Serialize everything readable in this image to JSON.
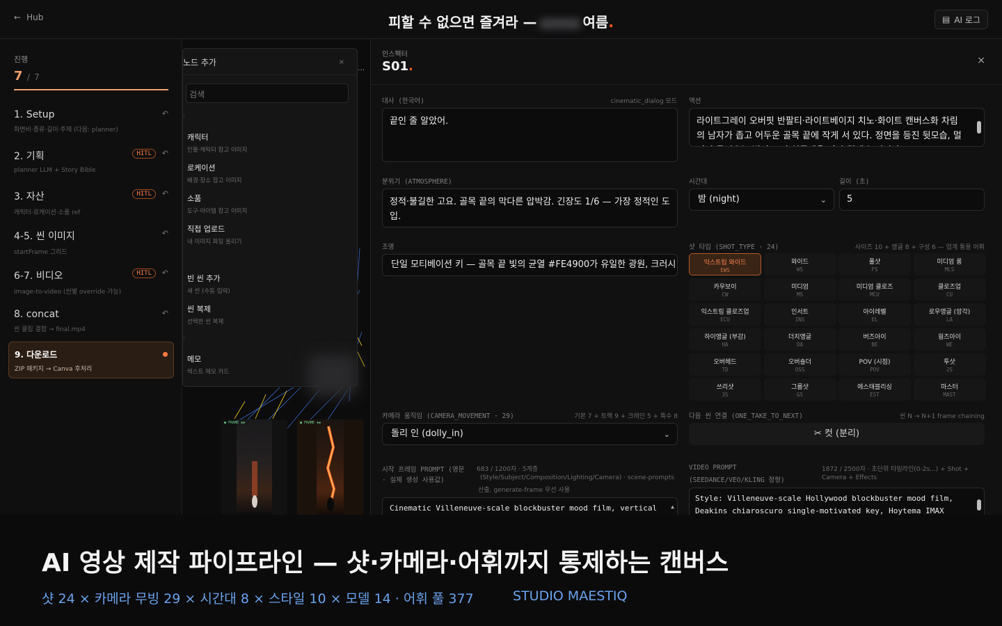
{
  "topbar": {
    "back_label": "Hub",
    "title_prefix": "피할 수 없으면 즐겨라 —",
    "title_suffix": "여름",
    "title_dot": ".",
    "ai_log_label": "AI 로그"
  },
  "progress": {
    "label": "진행",
    "current": "7",
    "separator": "/",
    "total": "7",
    "fraction": 1.0,
    "steps": [
      {
        "name": "1. Setup",
        "sub": "화면비·종류·길이·주제 (다음: planner)",
        "hitl": ""
      },
      {
        "name": "2. 기획",
        "sub": "planner LLM + Story Bible",
        "hitl": "HITL"
      },
      {
        "name": "3. 자산",
        "sub": "캐릭터·로케이션·소품 ref",
        "hitl": "HITL"
      },
      {
        "name": "4-5. 씬 이미지",
        "sub": "startFrame 그리드",
        "hitl": ""
      },
      {
        "name": "6-7. 비디오",
        "sub": "image-to-video (씬별 override 가능)",
        "hitl": "HITL"
      },
      {
        "name": "8. concat",
        "sub": "씬 클립 결합 → final.mp4",
        "hitl": ""
      },
      {
        "name": "9. 다운로드",
        "sub": "ZIP 패키지 → Canva 후처리",
        "hitl": ""
      }
    ],
    "undo_icon": "↶"
  },
  "node_menu": {
    "title": "노드 추가",
    "close": "×",
    "search_placeholder": "검색",
    "items": [
      {
        "title": "캐릭터",
        "desc": "인물·캐릭터 참고 이미지"
      },
      {
        "title": "로케이션",
        "desc": "배경·장소 참고 이미지"
      },
      {
        "title": "소품",
        "desc": "도구·아이템 참고 이미지"
      },
      {
        "title": "직접 업로드",
        "desc": "내 이미지 파일 올리기"
      },
      {
        "title": "빈 씬 추가",
        "desc": "새 씬 (수동 입력)"
      },
      {
        "title": "씬 복제",
        "desc": "선택한 씬 복제"
      },
      {
        "title": "메모",
        "desc": "텍스트 메모 카드"
      }
    ]
  },
  "inspector": {
    "label": "인스펙터",
    "scene_id": "S01",
    "dot": ".",
    "close": "×",
    "dialog": {
      "label": "대사 (한국어)",
      "hint": "cinematic_dialog 모드",
      "value": "끝인 줄 알았어."
    },
    "action": {
      "label": "액션",
      "value": "라이트그레이 오버핏 반팔티·라이트베이지 치노·화이트 캔버스화 차림의 남자가 좁고 어두운 골목 끝에 작게 서 있다. 정면을 등진 뒷모습, 멀리서 들어오는 빛이 그의 실루엣을 따라 길게 늘어진다."
    },
    "atmosphere": {
      "label": "분위기 (ATMOSPHERE)",
      "value": "정적·불길한 고요. 골목 끝의 막다른 압박감. 긴장도 1/6 — 가장 정적인 도입."
    },
    "time_of_day": {
      "label": "시간대",
      "value": "밤 (night)"
    },
    "length": {
      "label": "길이 (초)",
      "value": "5"
    },
    "lighting": {
      "label": "조명",
      "value": "단일 모티베이션 키 — 골목 끝 빛의 균열 #FE4900가 유일한 광원, 크러시 블랙"
    },
    "shot_type": {
      "label": "샷 타입 (SHOT_TYPE · 24)",
      "hint": "사이즈 10 + 앵글 8 + 구성 6 — 업계 통용 어휘",
      "options": [
        {
          "k": "익스트림 와이드",
          "c": "EWS",
          "selected": true
        },
        {
          "k": "와이드",
          "c": "WS"
        },
        {
          "k": "풀샷",
          "c": "FS"
        },
        {
          "k": "미디엄 롱",
          "c": "MLS"
        },
        {
          "k": "카우보이",
          "c": "CW"
        },
        {
          "k": "미디엄",
          "c": "MS"
        },
        {
          "k": "미디엄 클로즈",
          "c": "MCU"
        },
        {
          "k": "클로즈업",
          "c": "CU"
        },
        {
          "k": "익스트림 클로즈업",
          "c": "ECU"
        },
        {
          "k": "인서트",
          "c": "INS"
        },
        {
          "k": "아이레벨",
          "c": "EL"
        },
        {
          "k": "로우앵글 (앙각)",
          "c": "LA"
        },
        {
          "k": "하이앵글 (부감)",
          "c": "HA"
        },
        {
          "k": "더치앵글",
          "c": "DA"
        },
        {
          "k": "버즈아이",
          "c": "BE"
        },
        {
          "k": "웜즈아이",
          "c": "WE"
        },
        {
          "k": "오버헤드",
          "c": "TD"
        },
        {
          "k": "오버숄더",
          "c": "OSS"
        },
        {
          "k": "POV (시점)",
          "c": "POV"
        },
        {
          "k": "투샷",
          "c": "2S"
        },
        {
          "k": "쓰리샷",
          "c": "3S"
        },
        {
          "k": "그룹샷",
          "c": "GS"
        },
        {
          "k": "에스태블리싱",
          "c": "EST"
        },
        {
          "k": "마스터",
          "c": "MAST"
        }
      ]
    },
    "camera": {
      "label": "카메라 움직임 (CAMERA_MOVEMENT · 29)",
      "hint": "기본 7 + 트랙 9 + 크레인 5 + 특수 8",
      "value": "돌리 인 (dolly_in)"
    },
    "next": {
      "label": "다음 씬 연결 (ONE_TAKE_TO_NEXT)",
      "hint": "씬 N → N+1 frame chaining",
      "button": "✂ 컷 (분리)"
    },
    "start_prompt": {
      "label1": "시작 프레임 PROMPT (영문",
      "label2": "· 실제 생성 사용값)",
      "hint1": "683 / 1200자 · 5계층",
      "hint2": "(Style/Subject/Composition/Lighting/Camera) · scene-prompts",
      "hint3": "산출, generate-frame 우선 사용",
      "value": "Cinematic Villeneuve-scale blockbuster mood film, vertical"
    },
    "video_prompt": {
      "label1": "VIDEO PROMPT",
      "label2": "(SEEDANCE/VEO/KLING 정형)",
      "hint1": "1872 / 2500자 · 초단위 타임라인(0-2s...) + Shot +",
      "hint2": "Camera + Effects",
      "value": "Style: Villeneuve-scale Hollywood blockbuster mood film, Deakins chiaroscuro single-motivated key, Hoytema IMAX"
    }
  },
  "caption": {
    "title": "AI 영상 제작 파이프라인 — 샷·카메라·어휘까지 통제하는 캔버스",
    "subtitle": "샷 24 × 카메라 무빙 29 × 시간대 8 × 스타일 10 × 모델 14 · 어휘 풀 377",
    "brand": "STUDIO MAESTIQ"
  },
  "colors": {
    "accent": "#ff5a1f",
    "hitl": "#ff7b43",
    "caption": "#6aa2ea"
  }
}
